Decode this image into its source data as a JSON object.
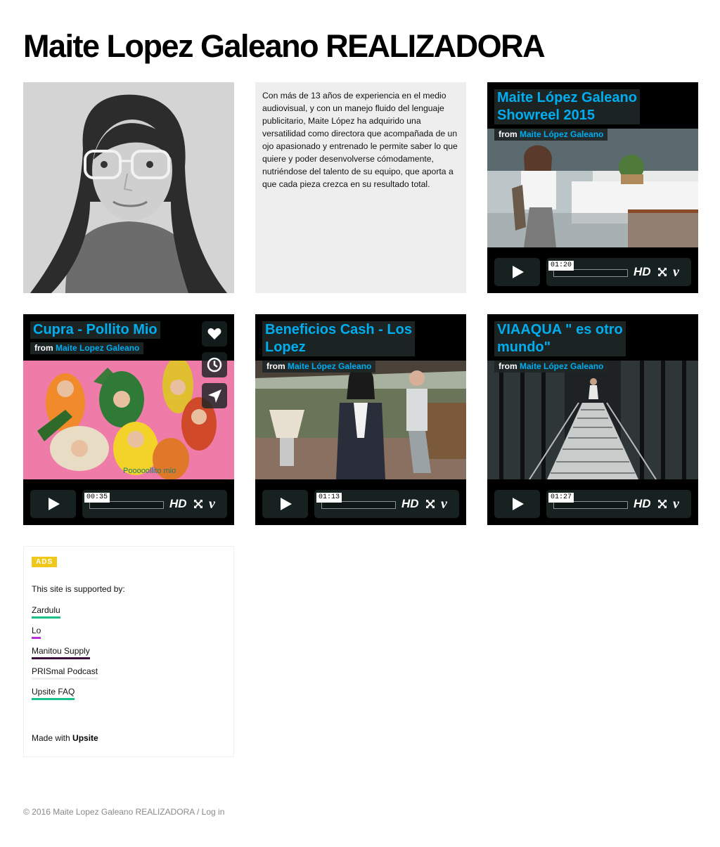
{
  "site": {
    "title": "Maite Lopez Galeano REALIZADORA"
  },
  "bio": {
    "text": "Con más de 13 años de experiencia en el medio audiovisual,  y con un manejo fluido del lenguaje publicitario, Maite López ha adquirido una versatilidad como directora que acompañada de un ojo apasionado y entrenado le permite saber lo que quiere y poder desenvolverse cómodamente, nutriéndose del talento de su equipo, que aporta a que cada pieza crezca en su resultado total."
  },
  "videos": [
    {
      "title_line1": "Maite López Galeano",
      "title_line2": "Showreel 2015",
      "by": "from",
      "owner": "Maite López Galeano",
      "time": "01:20",
      "hd": "HD"
    },
    {
      "title_line1": "Cupra - Pollito Mio",
      "title_line2": "",
      "by": "from",
      "owner": "Maite Lopez Galeano",
      "time": "00:35",
      "hd": "HD",
      "overlay_text": "Pooooollito mio"
    },
    {
      "title_line1": "Beneficios Cash - Los",
      "title_line2": "Lopez",
      "by": "from",
      "owner": "Maite López Galeano",
      "time": "01:13",
      "hd": "HD"
    },
    {
      "title_line1": "VIAAQUA \" es otro",
      "title_line2": "mundo\"",
      "by": "from",
      "owner": "Maite López Galeano",
      "time": "01:27",
      "hd": "HD"
    }
  ],
  "ads": {
    "badge": "ADS",
    "intro": "This site is supported by:",
    "sponsors": [
      {
        "label": "Zardulu",
        "color": "#1bbf8c"
      },
      {
        "label": "Lo",
        "color": "#b830d8"
      },
      {
        "label": "Manitou Supply",
        "color": "#3a0f3a"
      },
      {
        "label": "PRISmal Podcast",
        "color": "#eeeeee"
      },
      {
        "label": "Upsite FAQ",
        "color": "#1bbf8c"
      }
    ],
    "made_with_prefix": "Made with",
    "made_with_brand": "Upsite"
  },
  "footer": {
    "copyright": "© 2016 Maite Lopez Galeano REALIZADORA",
    "separator": "/",
    "login": "Log in"
  },
  "colors": {
    "vimeo_blue": "#00adef",
    "ads_badge": "#f0c81c",
    "bio_bg": "#eeeeee"
  },
  "icons": [
    "play-icon",
    "fullscreen-icon",
    "vimeo-icon",
    "heart-icon",
    "clock-icon",
    "send-icon"
  ]
}
